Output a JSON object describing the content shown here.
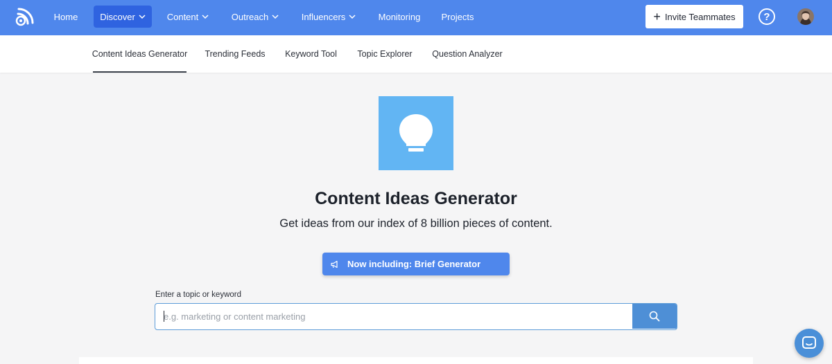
{
  "colors": {
    "nav_bg": "#4f87ec",
    "nav_active": "#2f63e0",
    "hero_icon_bg": "#62b5f3",
    "search_button": "#4e8fd6",
    "chat_bubble": "#4a8fd8"
  },
  "topnav": {
    "logo_icon": "rss-logo-icon",
    "items": [
      {
        "label": "Home",
        "dropdown": false
      },
      {
        "label": "Discover",
        "dropdown": true,
        "active": true
      },
      {
        "label": "Content",
        "dropdown": true
      },
      {
        "label": "Outreach",
        "dropdown": true
      },
      {
        "label": "Influencers",
        "dropdown": true
      },
      {
        "label": "Monitoring",
        "dropdown": false
      },
      {
        "label": "Projects",
        "dropdown": false
      }
    ],
    "invite_label": "Invite Teammates",
    "help_icon": "question-circle-icon",
    "avatar_icon": "user-avatar"
  },
  "subnav": {
    "tabs": [
      {
        "label": "Content Ideas Generator",
        "active": true
      },
      {
        "label": "Trending Feeds"
      },
      {
        "label": "Keyword Tool"
      },
      {
        "label": "Topic Explorer"
      },
      {
        "label": "Question Analyzer"
      }
    ]
  },
  "main": {
    "hero_icon": "lightbulb-icon",
    "title": "Content Ideas Generator",
    "subtitle": "Get ideas from our index of 8 billion pieces of content.",
    "announce_icon": "megaphone-icon",
    "announce_label": "Now including: Brief Generator",
    "search": {
      "label": "Enter a topic or keyword",
      "placeholder": "e.g. marketing or content marketing",
      "value": "",
      "button_icon": "search-icon"
    }
  },
  "chat": {
    "icon": "chat-icon"
  }
}
